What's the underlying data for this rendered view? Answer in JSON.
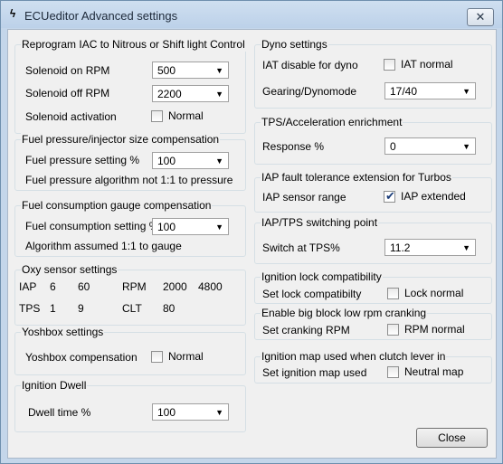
{
  "window": {
    "title": "ECUeditor Advanced settings",
    "close_glyph": "✕"
  },
  "reprogram": {
    "title": "Reprogram IAC to Nitrous or Shift light Control",
    "on_rpm_label": "Solenoid on RPM",
    "on_rpm_value": "500",
    "off_rpm_label": "Solenoid off RPM",
    "off_rpm_value": "2200",
    "activation_label": "Solenoid activation",
    "activation_check_label": "Normal"
  },
  "fuel_pressure": {
    "title": "Fuel pressure/injector size compensation",
    "setting_label": "Fuel pressure setting %",
    "setting_value": "100",
    "note": "Fuel pressure algorithm not 1:1 to pressure"
  },
  "fuel_consumption": {
    "title": "Fuel consumption gauge compensation",
    "setting_label": "Fuel consumption setting %",
    "setting_value": "100",
    "note": "Algorithm assumed 1:1 to gauge"
  },
  "oxy": {
    "title": "Oxy sensor settings",
    "row1": [
      "IAP",
      "6",
      "60",
      "RPM",
      "2000",
      "4800"
    ],
    "row2": [
      "TPS",
      "1",
      "9",
      "CLT",
      "80"
    ]
  },
  "yoshbox": {
    "title": "Yoshbox settings",
    "comp_label": "Yoshbox compensation",
    "check_label": "Normal"
  },
  "dwell": {
    "title": "Ignition Dwell",
    "time_label": "Dwell time %",
    "time_value": "100"
  },
  "dyno": {
    "title": "Dyno settings",
    "iat_label": "IAT disable for dyno",
    "iat_check_label": "IAT normal",
    "gearing_label": "Gearing/Dynomode",
    "gearing_value": "17/40"
  },
  "tps_accel": {
    "title": "TPS/Acceleration enrichment",
    "response_label": "Response  %",
    "response_value": "0"
  },
  "iap_fault": {
    "title": "IAP fault tolerance extension for Turbos",
    "range_label": "IAP sensor range",
    "check_label": "IAP extended",
    "checked": true
  },
  "switching": {
    "title": "IAP/TPS switching point",
    "switch_label": "Switch at TPS%",
    "switch_value": "11.2"
  },
  "ign_lock": {
    "title": "Ignition lock compatibility",
    "set_label": "Set lock compatibilty",
    "check_label": "Lock normal"
  },
  "big_block": {
    "title": "Enable big block low rpm cranking",
    "set_label": "Set cranking RPM",
    "check_label": "RPM normal"
  },
  "ign_map": {
    "title": "Ignition map used when clutch lever in",
    "set_label": "Set ignition map used",
    "check_label": "Neutral map"
  },
  "footer": {
    "close_label": "Close"
  },
  "icons": {
    "combo_arrow": "▼",
    "check_tick": "✔",
    "app_icon": "ϟ"
  }
}
